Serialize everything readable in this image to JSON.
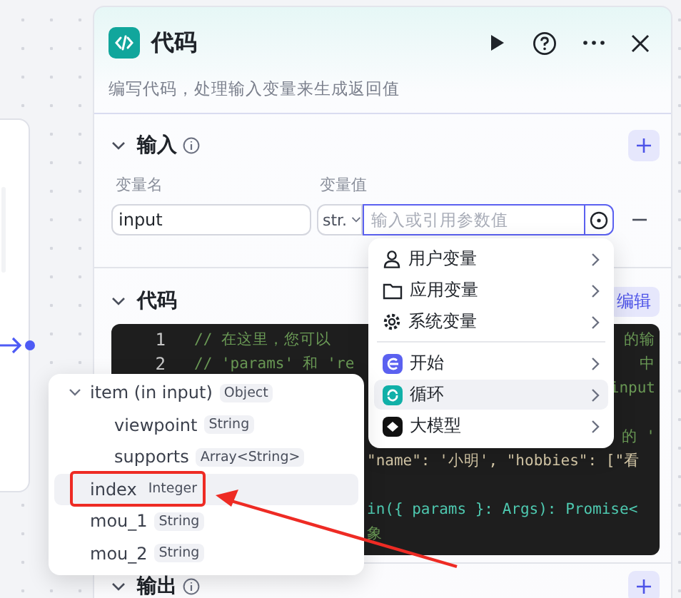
{
  "panel": {
    "title": "代码",
    "description": "编写代码，处理输入变量来生成返回值",
    "input_section": {
      "title": "输入",
      "expanded": true,
      "columns": [
        "变量名",
        "变量值"
      ],
      "variables": [
        {
          "name": "input",
          "type": "str.",
          "placeholder": "输入或引用参数值"
        }
      ]
    },
    "code_section": {
      "title": "代码",
      "expanded": true,
      "edit_button": "编辑",
      "lines": [
        {
          "number": "1",
          "fragments": [
            {
              "text": "// 在这里，您可以",
              "kind": "comment"
            },
            {
              "text": "的输",
              "kind": "comment"
            }
          ]
        },
        {
          "number": "2",
          "fragments": [
            {
              "text": "// 'params' 和 're",
              "kind": "comment"
            },
            {
              "text": "中",
              "kind": "comment"
            }
          ]
        },
        {
          "fragments": [
            {
              "text": "input",
              "kind": "comment"
            }
          ]
        },
        {
          "fragments": [
            {
              "text": "的 '",
              "kind": "comment"
            }
          ]
        },
        {
          "fragments": [
            {
              "text": "\"name\": '小明', \"hobbies\": [\"看",
              "kind": "plain"
            }
          ]
        },
        {
          "fragments": [
            {
              "text": "in({ params }: Args): Promise<",
              "kind": "code"
            }
          ]
        },
        {
          "fragments": [
            {
              "text": "象",
              "kind": "comment"
            }
          ]
        }
      ]
    },
    "output_section": {
      "title": "输出"
    }
  },
  "reference_menu": {
    "groups": [
      [
        {
          "label": "用户变量",
          "selected": false
        },
        {
          "label": "应用变量",
          "selected": false
        },
        {
          "label": "系统变量",
          "selected": false
        }
      ],
      [
        {
          "label": "开始",
          "selected": false
        },
        {
          "label": "循环",
          "selected": true
        },
        {
          "label": "大模型",
          "selected": false
        }
      ]
    ]
  },
  "variable_tree": [
    {
      "name": "item (in input)",
      "type": "Object",
      "expanded": true,
      "selected": false,
      "children": [
        {
          "name": "viewpoint",
          "type": "String",
          "selected": false
        },
        {
          "name": "supports",
          "type": "Array<String>",
          "selected": false
        }
      ]
    },
    {
      "name": "index",
      "type": "Integer",
      "selected": true
    },
    {
      "name": "mou_1",
      "type": "String",
      "selected": false
    },
    {
      "name": "mou_2",
      "type": "String",
      "selected": false
    }
  ]
}
